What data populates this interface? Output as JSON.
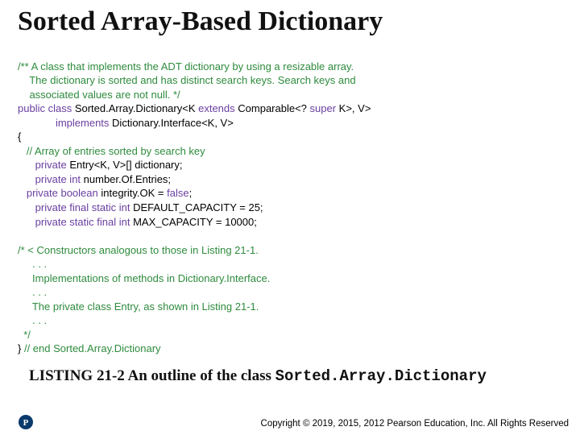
{
  "title": "Sorted Array-Based Dictionary",
  "code": {
    "c1": "/** A class that implements the ADT dictionary by using a resizable array.",
    "c2": "    The dictionary is sorted and has distinct search keys. Search keys and",
    "c3": "    associated values are not null. */",
    "l1a": "public class ",
    "l1b": "Sorted.Array.Dictionary<K ",
    "l1c": "extends ",
    "l1d": "Comparable<? ",
    "l1e": "super ",
    "l1f": "K>, V>",
    "l2a": "             implements ",
    "l2b": "Dictionary.Interface<K, V>",
    "l3": "{",
    "c4": "   // Array of entries sorted by search key",
    "l4a": "      private ",
    "l4b": "Entry<K, V>[] dictionary;",
    "l5a": "      private int ",
    "l5b": "number.Of.Entries;",
    "l6a": "   private boolean ",
    "l6b": "integrity.OK = ",
    "l6c": "false",
    "l6d": ";",
    "l7a": "      private final static int ",
    "l7b": "DEFAULT_CAPACITY = 25;",
    "l8a": "      private static final int ",
    "l8b": "MAX_CAPACITY = 10000;",
    "c5": "/* < Constructors analogous to those in Listing 21-1.",
    "c6": "     . . .",
    "c7": "     Implementations of methods in Dictionary.Interface.",
    "c8": "     . . .",
    "c9": "     The private class Entry, as shown in Listing 21-1.",
    "c10": "     . . .",
    "c11": "  */",
    "l9a": "} ",
    "l9b": "// end Sorted.Array.Dictionary"
  },
  "caption": {
    "lead": "LISTING 21-2 An outline of the class ",
    "mono": "Sorted.Array.Dictionary"
  },
  "footer": "Copyright © 2019, 2015, 2012 Pearson Education, Inc. All Rights Reserved"
}
